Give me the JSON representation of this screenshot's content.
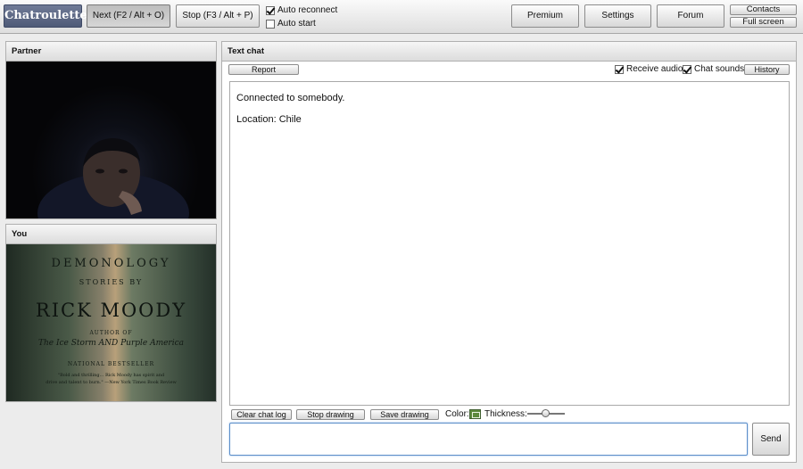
{
  "app": {
    "logo": "Chatroulette"
  },
  "toolbar": {
    "next": "Next (F2 / Alt + O)",
    "stop": "Stop (F3 / Alt + P)",
    "auto_reconnect": {
      "label": "Auto reconnect",
      "checked": true
    },
    "auto_start": {
      "label": "Auto start",
      "checked": false
    },
    "premium": "Premium",
    "settings": "Settings",
    "forum": "Forum",
    "contacts": "Contacts",
    "full_screen": "Full screen"
  },
  "partner": {
    "title": "Partner",
    "webcam_icon": "webcam-feed"
  },
  "you": {
    "title": "You",
    "webcam_icon": "webcam-feed",
    "book_cover": {
      "title": "DEMONOLOGY",
      "subtitle": "STORIES BY",
      "author": "RICK MOODY",
      "author_of": "AUTHOR OF",
      "previous_works": "The Ice Storm AND Purple America",
      "badge": "NATIONAL BESTSELLER",
      "blurb_1": "\"Bold and thrilling... Rick Moody has spirit and",
      "blurb_2": "drive and talent to burn.\" —New York Times Book Review"
    }
  },
  "chat": {
    "title": "Text chat",
    "report": "Report",
    "receive_audio": {
      "label": "Receive audio",
      "checked": true
    },
    "chat_sounds": {
      "label": "Chat sounds",
      "checked": true
    },
    "history": "History",
    "messages": [
      "Connected to somebody.",
      "Location: Chile"
    ],
    "clear_chat_log": "Clear chat log",
    "stop_drawing": "Stop drawing",
    "save_drawing": "Save drawing",
    "color_label": "Color:",
    "color_value": "#5c8a3c",
    "thickness_label": "Thickness:",
    "thickness_value": 0.5,
    "input_value": "",
    "send": "Send"
  },
  "colors": {
    "logo_bg": "#5a6582",
    "input_focus": "#5b8ec9"
  }
}
